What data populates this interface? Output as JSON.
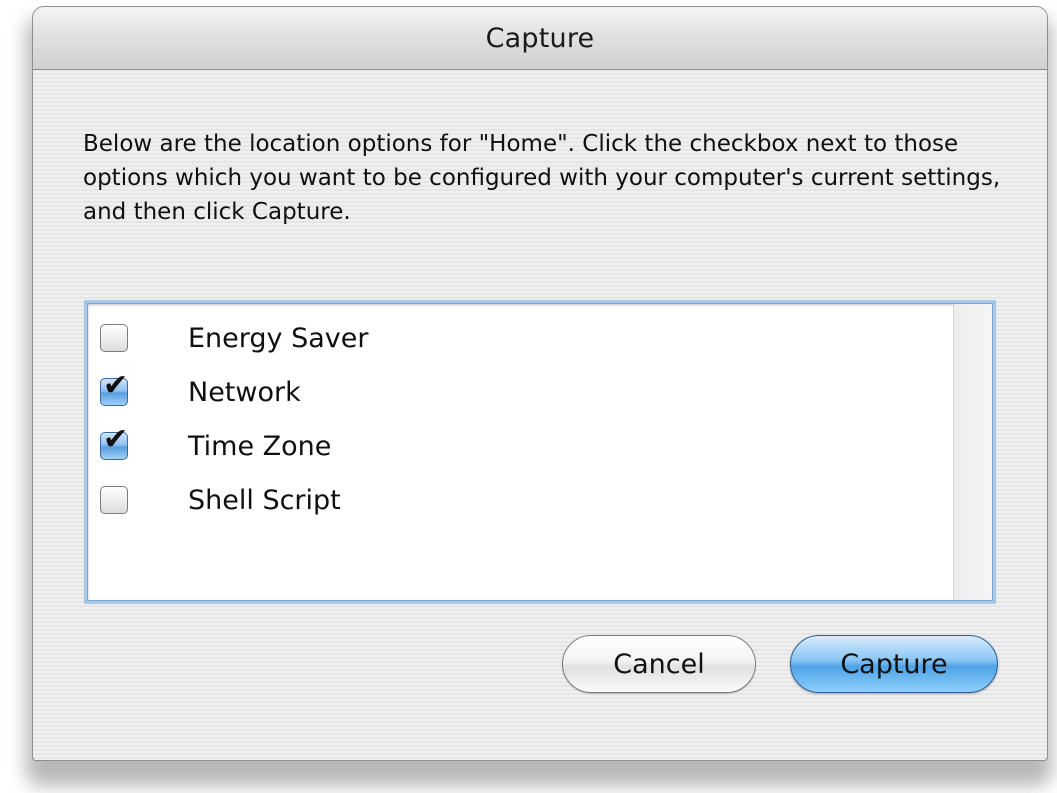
{
  "window": {
    "title": "Capture"
  },
  "message": "Below are the location options for \"Home\".  Click the checkbox next to those options which you want to be configured with your computer's current settings, and then click Capture.",
  "options": [
    {
      "label": "Energy Saver",
      "checked": false
    },
    {
      "label": "Network",
      "checked": true
    },
    {
      "label": "Time Zone",
      "checked": true
    },
    {
      "label": "Shell Script",
      "checked": false
    }
  ],
  "buttons": {
    "cancel_label": "Cancel",
    "capture_label": "Capture"
  },
  "colors": {
    "accent": "#4fa2e6",
    "focus_ring": "#a8c8ea"
  },
  "icons": {
    "checkmark": "checkmark-icon"
  }
}
